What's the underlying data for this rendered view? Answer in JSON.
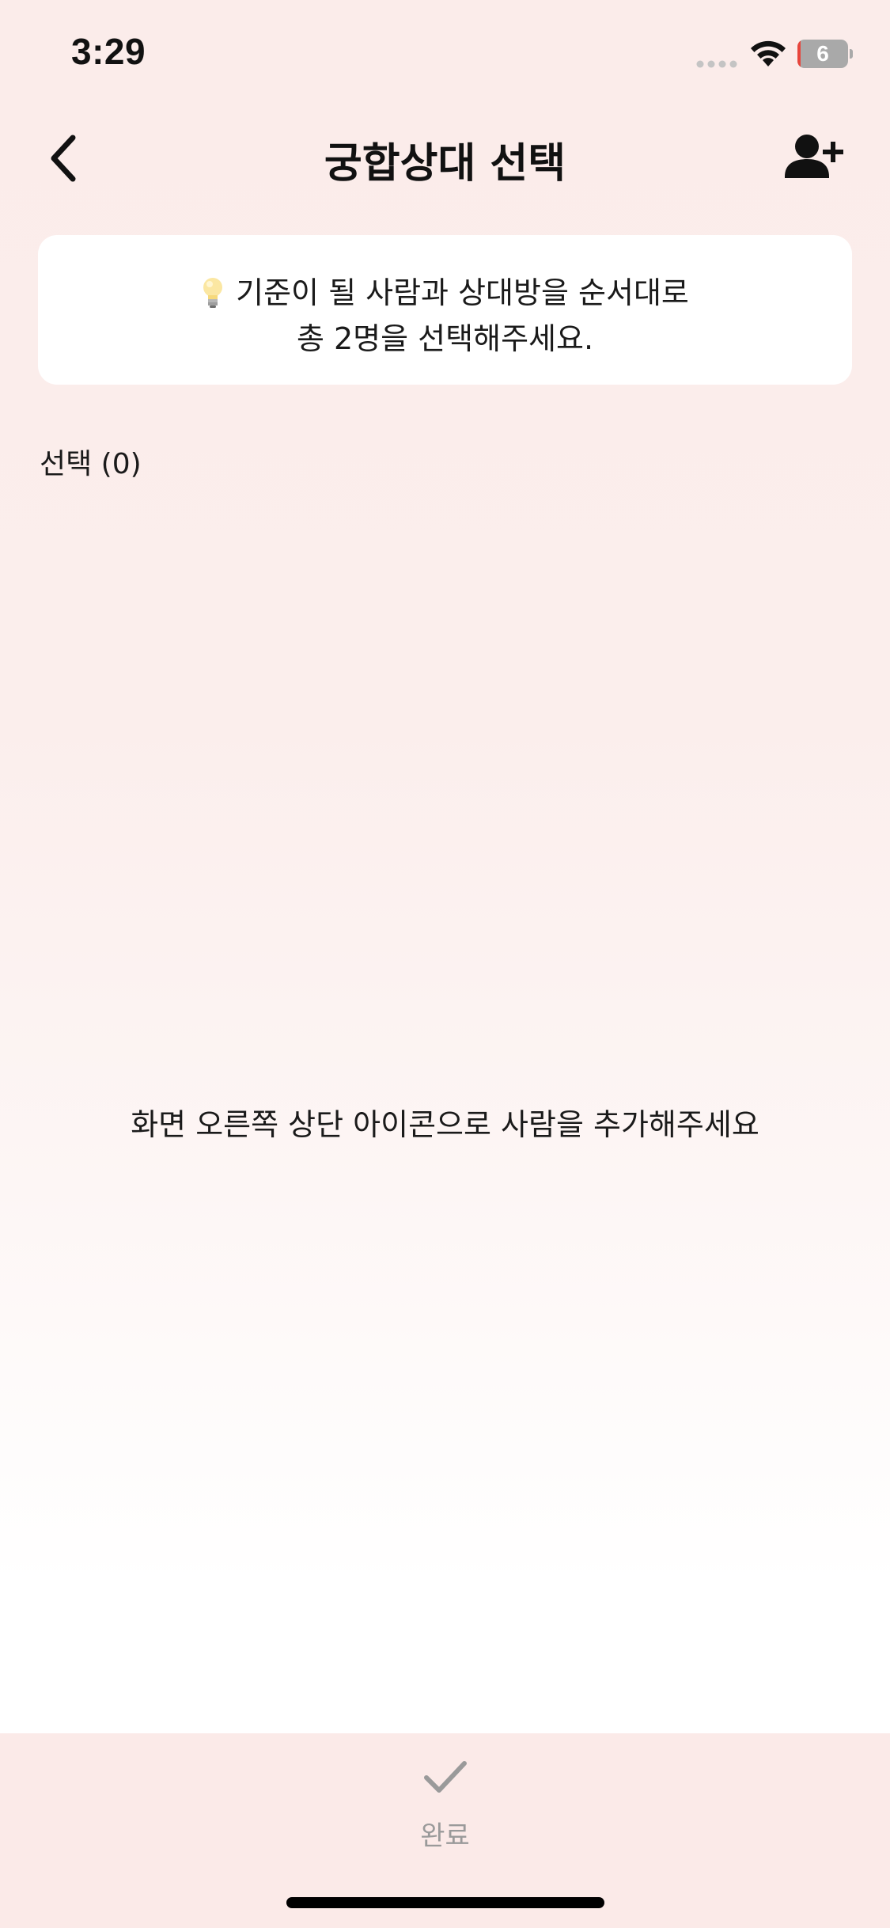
{
  "status_bar": {
    "time": "3:29",
    "battery_level": "6",
    "battery_fraction": 0.06,
    "signal_icon": "cellular-dots-icon",
    "wifi_icon": "wifi-icon"
  },
  "nav": {
    "title": "궁합상대 선택",
    "back_icon": "chevron-left-icon",
    "add_icon": "person-add-icon"
  },
  "info_card": {
    "icon": "lightbulb-icon",
    "line1": "기준이 될 사람과 상대방을 순서대로",
    "line2": "총 2명을 선택해주세요."
  },
  "selection": {
    "count_label": "선택 (0)"
  },
  "empty_state": {
    "message": "화면 오른쪽 상단 아이콘으로 사람을 추가해주세요"
  },
  "bottom_bar": {
    "done_label": "완료",
    "done_icon": "checkmark-icon"
  },
  "colors": {
    "background_top": "#fbecea",
    "card_background": "#ffffff",
    "bottom_bar": "#fbeae8",
    "disabled_gray": "#9a9a9a",
    "battery_low": "#e8453c"
  }
}
